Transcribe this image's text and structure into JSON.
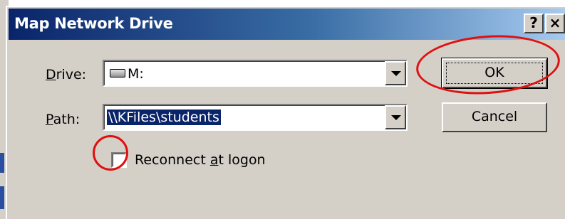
{
  "window": {
    "title": "Map Network Drive",
    "help_label": "?",
    "close_label": "×"
  },
  "form": {
    "drive_label": "Drive:",
    "drive_value": "M:",
    "path_label": "Path:",
    "path_value": "\\\\KFiles\\students",
    "reconnect_label": "Reconnect at logon",
    "reconnect_checked": false
  },
  "buttons": {
    "ok_label": "OK",
    "cancel_label": "Cancel"
  },
  "annotations": {
    "color": "#e01010",
    "targets": [
      "ok-button",
      "reconnect-checkbox"
    ]
  },
  "colors": {
    "dialog_face": "#d4d0c8",
    "titlebar_start": "#0a246a",
    "titlebar_end": "#a6caf0",
    "selection": "#0a246a"
  }
}
